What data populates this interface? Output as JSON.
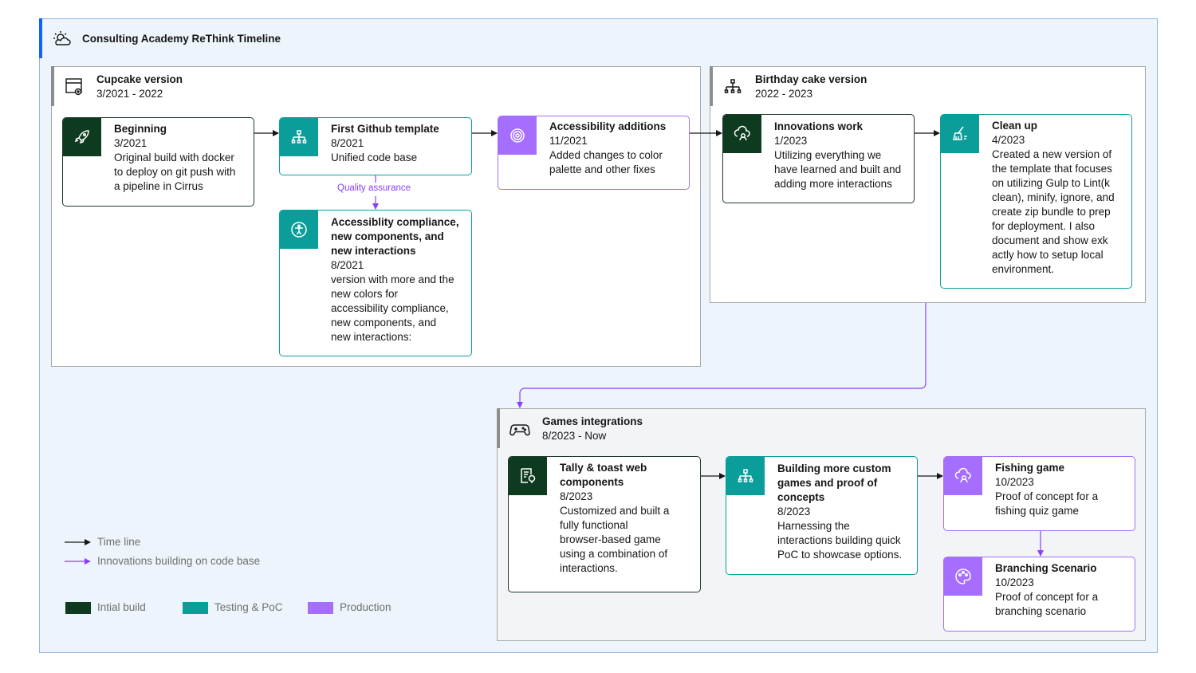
{
  "title": "Consulting Academy ReThink Timeline",
  "groups": {
    "cupcake": {
      "title": "Cupcake version",
      "dates": "3/2021 - 2022"
    },
    "birthday": {
      "title": "Birthday cake version",
      "dates": "2022 - 2023"
    },
    "games": {
      "title": "Games integrations",
      "dates": "8/2023 - Now"
    }
  },
  "cards": {
    "beginning": {
      "title": "Beginning",
      "date": "3/2021",
      "lines": [
        "Original build with docker",
        "to deploy on git push with",
        "a pipeline in Cirrus"
      ],
      "category": "initial",
      "icon": "rocket-icon"
    },
    "github": {
      "title": "First Github template",
      "date": "8/2021",
      "lines": [
        "Unified code base"
      ],
      "category": "testing",
      "icon": "hierarchy-icon"
    },
    "a11y_additions": {
      "title": "Accessibility additions",
      "date": "11/2021",
      "lines": [
        "Added changes to color",
        "palette and other fixes"
      ],
      "category": "production",
      "icon": "target-icon"
    },
    "a11y_compliance": {
      "title_lines": [
        "Accessiblity compliance,",
        "new components, and",
        "new interactions"
      ],
      "date": "8/2021",
      "lines": [
        "version with more and the",
        "new colors for",
        "accessibility compliance,",
        "new components, and",
        "new interactions:"
      ],
      "category": "testing",
      "icon": "accessibility-icon"
    },
    "innovations": {
      "title": "Innovations work",
      "date": "1/2023",
      "lines": [
        "Utilizing everything we",
        "have learned and built and",
        "adding more interactions"
      ],
      "category": "initial",
      "icon": "cloud-worker-icon"
    },
    "cleanup": {
      "title": "Clean up",
      "date": "4/2023",
      "lines": [
        "Created a new version of",
        "the template that focuses",
        "on utilizing Gulp to Lint(k",
        "clean), minify, ignore, and",
        "create zip bundle to prep",
        "for deployment. I also",
        "document and show exk",
        "actly how to setup local",
        "environment."
      ],
      "category": "testing",
      "icon": "broom-icon"
    },
    "tally": {
      "title_lines": [
        "Tally  & toast web",
        "components"
      ],
      "date": "8/2023",
      "lines": [
        "Customized and built a",
        "fully functional",
        "browser-based game",
        "using a combination of",
        "interactions."
      ],
      "category": "initial",
      "icon": "document-idea-icon"
    },
    "custom_games": {
      "title_lines": [
        "Building more custom",
        "games and proof of",
        "concepts"
      ],
      "date": "8/2023",
      "lines": [
        "Harnessing the",
        "interactions building quick",
        "PoC to showcase options."
      ],
      "category": "testing",
      "icon": "hierarchy-icon"
    },
    "fishing": {
      "title": "Fishing game",
      "date": "10/2023",
      "lines": [
        "Proof of concept for a",
        "fishing quiz game"
      ],
      "category": "production",
      "icon": "cloud-worker-icon"
    },
    "branching": {
      "title": "Branching Scenario",
      "date": "10/2023",
      "lines": [
        "Proof of concept for a",
        "branching scenario"
      ],
      "category": "production",
      "icon": "palette-icon"
    }
  },
  "connector_labels": {
    "quality_assurance": "Quality assurance"
  },
  "legend": {
    "timeline": "Time line",
    "innovations": "Innovations building on code base",
    "initial": "Intial build",
    "testing": "Testing & PoC",
    "production": "Production"
  },
  "colors": {
    "initial": "#0e3b1f",
    "testing": "#0a9d9a",
    "production": "#a56eff",
    "timeline_arrow": "#161616",
    "innovation_arrow": "#8a3ffc"
  }
}
